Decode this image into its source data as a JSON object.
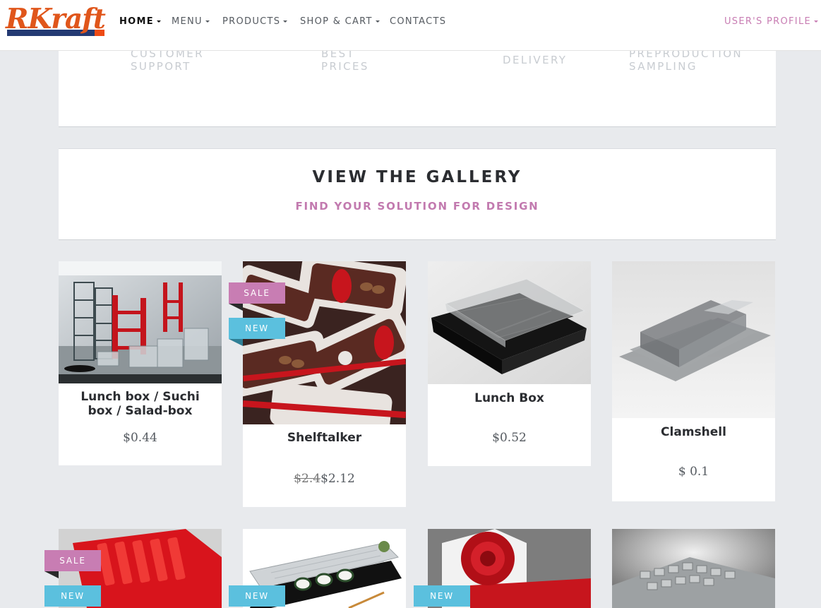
{
  "brand": {
    "logo_text": "RKraft"
  },
  "nav": {
    "items": [
      {
        "label": "HOME",
        "caret": true
      },
      {
        "label": "MENU",
        "caret": true
      },
      {
        "label": "PRODUCTS",
        "caret": true
      },
      {
        "label": "SHOP & CART",
        "caret": true
      },
      {
        "label": "CONTACTS",
        "caret": false
      }
    ],
    "profile": "USER'S PROFILE"
  },
  "features": [
    "CUSTOMER\nSUPPORT",
    "BEST\nPRICES",
    "DELIVERY",
    "PREPRODUCTION\nSAMPLING"
  ],
  "gallery": {
    "title": "VIEW THE GALLERY",
    "subtitle": "FIND YOUR SOLUTION FOR DESIGN"
  },
  "badges": {
    "sale": "SALE",
    "new": "NEW"
  },
  "products": [
    {
      "name": "Lunch box / Suchi box / Salad-box",
      "price": "$0.44"
    },
    {
      "name": "Shelftalker",
      "old_price": "$2.4",
      "price": "$2.12",
      "badges": [
        "SALE",
        "NEW"
      ]
    },
    {
      "name": "Lunch Box",
      "price": "$0.52"
    },
    {
      "name": "Clamshell",
      "price": "$ 0.1"
    }
  ],
  "colors": {
    "accent_pink": "#c87db3",
    "accent_blue": "#5bc0de",
    "logo_orange": "#e0561b",
    "logo_navy": "#243a73"
  }
}
